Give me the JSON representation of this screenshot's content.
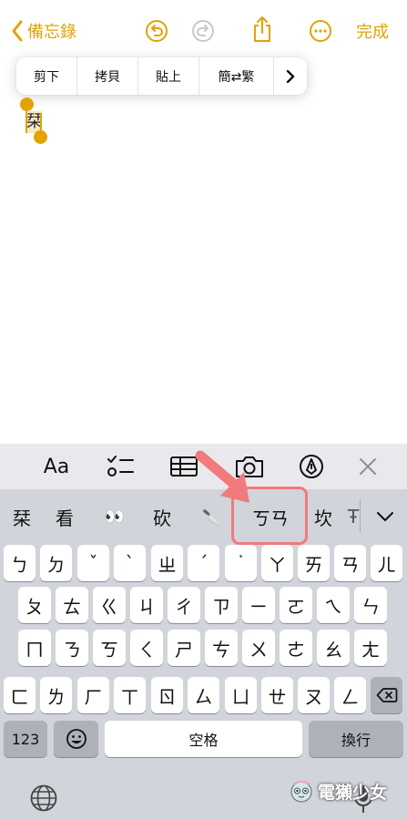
{
  "nav": {
    "back_label": "備忘錄",
    "done_label": "完成"
  },
  "edit_menu": {
    "items": [
      "剪下",
      "拷貝",
      "貼上",
      "簡⇄繁"
    ],
    "more_label": "›"
  },
  "note": {
    "selected_text": "栞"
  },
  "toolbar": {
    "format_label": "Aa"
  },
  "candidates": {
    "items": [
      "栞",
      "看",
      "👀",
      "砍",
      "🔪",
      "ㄎㄢ",
      "坎",
      "Ŧ"
    ],
    "expand_icon": "chevron-down-icon"
  },
  "keyboard": {
    "row1": [
      "ㄅ",
      "ㄉ",
      "ˇ",
      "ˋ",
      "ㄓ",
      "ˊ",
      "˙",
      "ㄚ",
      "ㄞ",
      "ㄢ",
      "ㄦ"
    ],
    "row2": [
      "ㄆ",
      "ㄊ",
      "ㄍ",
      "ㄐ",
      "ㄔ",
      "ㄗ",
      "ㄧ",
      "ㄛ",
      "ㄟ",
      "ㄣ"
    ],
    "row3": [
      "ㄇ",
      "ㄋ",
      "ㄎ",
      "ㄑ",
      "ㄕ",
      "ㄘ",
      "ㄨ",
      "ㄜ",
      "ㄠ",
      "ㄤ"
    ],
    "row4": [
      "ㄈ",
      "ㄌ",
      "ㄏ",
      "ㄒ",
      "ㄖ",
      "ㄙ",
      "ㄩ",
      "ㄝ",
      "ㄡ",
      "ㄥ"
    ],
    "numbers_label": "123",
    "space_label": "空格",
    "return_label": "換行"
  },
  "watermark": {
    "text": "電獺少女"
  },
  "colors": {
    "accent": "#e0a300",
    "highlight": "#f07a7c"
  }
}
